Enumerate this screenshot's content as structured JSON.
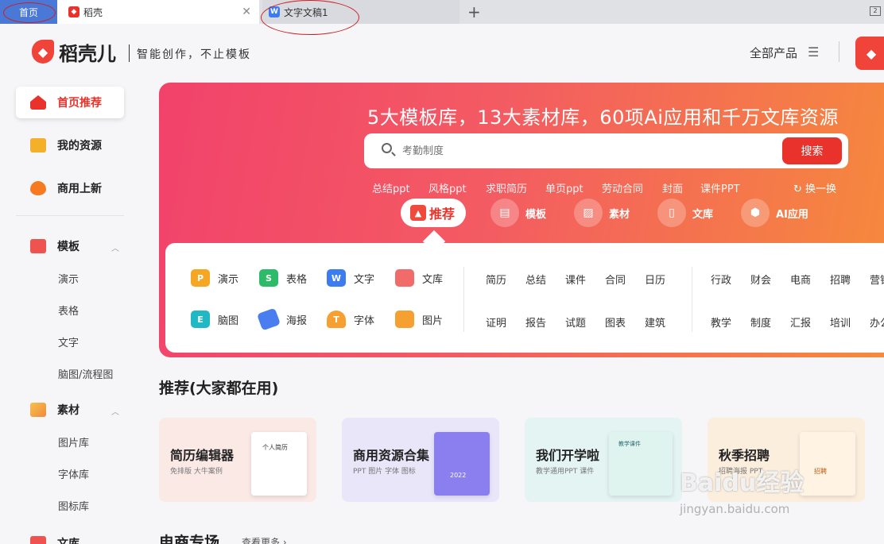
{
  "tabs": {
    "home": "首页",
    "daoke": "稻壳",
    "doc": "文字文稿1",
    "doc_icon": "W",
    "add": "+",
    "close": "✕",
    "window_badge": "2"
  },
  "header": {
    "logo_text": "稻壳儿",
    "slogan": "智能创作，不止模板",
    "all_products": "全部产品",
    "menu_icon": "☰"
  },
  "sidebar": {
    "main": [
      {
        "label": "首页推荐"
      },
      {
        "label": "我的资源"
      },
      {
        "label": "商用上新"
      }
    ],
    "template": {
      "label": "模板",
      "items": [
        "演示",
        "表格",
        "文字",
        "脑图/流程图"
      ]
    },
    "material": {
      "label": "素材",
      "items": [
        "图片库",
        "字体库",
        "图标库"
      ]
    },
    "library": {
      "label": "文库"
    }
  },
  "banner": {
    "title": "5大模板库，13大素材库，60项Ai应用和千万文库资源",
    "search_placeholder": "考勤制度",
    "search_button": "搜索",
    "hot_words": [
      "总结ppt",
      "风格ppt",
      "求职简历",
      "单页ppt",
      "劳动合同",
      "封面",
      "课件PPT"
    ],
    "refresh": "换一换",
    "categories": [
      "推荐",
      "模板",
      "素材",
      "文库",
      "AI应用"
    ]
  },
  "panel": {
    "tools": [
      {
        "label": "演示",
        "icon": "P",
        "color": "#f5a623"
      },
      {
        "label": "表格",
        "icon": "S",
        "color": "#2dbb6a"
      },
      {
        "label": "文字",
        "icon": "W",
        "color": "#3d7bf0"
      },
      {
        "label": "文库",
        "icon": "",
        "color": "#f26b6b"
      },
      {
        "label": "脑图",
        "icon": "E",
        "color": "#20b8c4"
      },
      {
        "label": "海报",
        "icon": "",
        "color": "#4a7ef0"
      },
      {
        "label": "字体",
        "icon": "T",
        "color": "#f5a030"
      },
      {
        "label": "图片",
        "icon": "",
        "color": "#f5a030"
      }
    ],
    "kw_row1_a": [
      "简历",
      "总结",
      "课件",
      "合同",
      "日历"
    ],
    "kw_row2_a": [
      "证明",
      "报告",
      "试题",
      "图表",
      "建筑"
    ],
    "kw_row1_b": [
      "行政",
      "财会",
      "电商",
      "招聘",
      "营销"
    ],
    "kw_row2_b": [
      "教学",
      "制度",
      "汇报",
      "培训",
      "办公"
    ]
  },
  "recommend": {
    "title": "推荐(大家都在用)",
    "cards": [
      {
        "title": "简历编辑器",
        "sub": "免排版 大牛案例",
        "bg": "#fbe9e6",
        "art": "个人简历"
      },
      {
        "title": "商用资源合集",
        "sub": "PPT 图片 字体 图标",
        "bg": "#e9e6fa",
        "art": "2022"
      },
      {
        "title": "我们开学啦",
        "sub": "教学通用PPT 课件",
        "bg": "#e4f4f2",
        "art": "教学课件"
      },
      {
        "title": "秋季招聘",
        "sub": "招聘海报 PPT",
        "bg": "#fbeedd",
        "art": "招聘"
      }
    ]
  },
  "section": {
    "title": "电商专场",
    "more": "查看更多 ›"
  },
  "watermark": {
    "main": "Baidu经验",
    "sub": "jingyan.baidu.com"
  }
}
